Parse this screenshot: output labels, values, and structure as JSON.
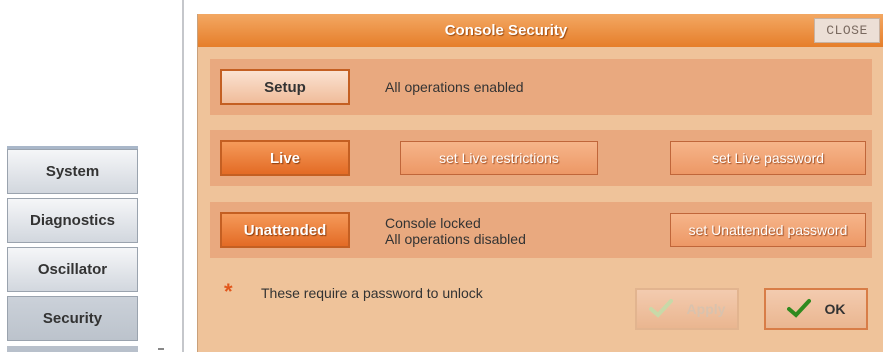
{
  "nav": {
    "items": [
      {
        "label": "System"
      },
      {
        "label": "Diagnostics"
      },
      {
        "label": "Oscillator"
      },
      {
        "label": "Security"
      }
    ]
  },
  "dialog": {
    "title": "Console Security",
    "close_label": "CLOSE",
    "modes": {
      "setup": {
        "label": "Setup",
        "desc": "All operations enabled"
      },
      "live": {
        "label": "Live",
        "restrictions_label": "set Live restrictions",
        "password_label": "set Live password"
      },
      "unattended": {
        "label": "Unattended",
        "desc_line1": "Console locked",
        "desc_line2": "All operations disabled",
        "password_label": "set Unattended password"
      }
    },
    "note": "These require a password to unlock",
    "apply_label": "Apply",
    "ok_label": "OK"
  }
}
